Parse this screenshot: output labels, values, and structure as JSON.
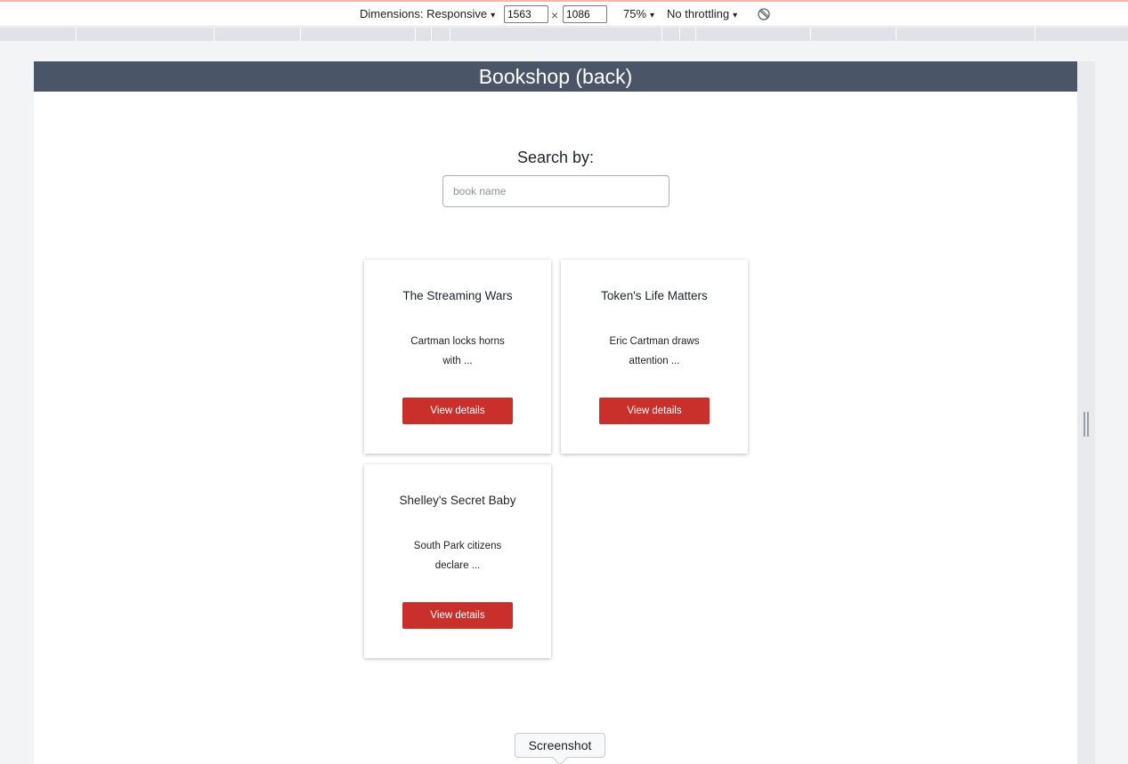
{
  "devtools": {
    "dimensions_label": "Dimensions: Responsive",
    "width_value": "1563",
    "times_symbol": "×",
    "height_value": "1086",
    "zoom_label": "75%",
    "throttling_label": "No throttling",
    "caret": "▾"
  },
  "app": {
    "title": "Bookshop (back)",
    "search_label": "Search by:",
    "search_placeholder": "book name",
    "search_value": ""
  },
  "books": [
    {
      "title": "The Streaming Wars",
      "desc_line1": "Cartman locks horns",
      "desc_line2": "with ...",
      "button": "View details"
    },
    {
      "title": "Token's Life Matters",
      "desc_line1": "Eric Cartman draws",
      "desc_line2": "attention ...",
      "button": "View details"
    },
    {
      "title": "Shelley's Secret Baby",
      "desc_line1": "South Park citizens",
      "desc_line2": "declare ...",
      "button": "View details"
    }
  ],
  "tooltip": {
    "label": "Screenshot"
  },
  "colors": {
    "header_bg": "#4a5568",
    "button_bg": "#c9302c"
  }
}
